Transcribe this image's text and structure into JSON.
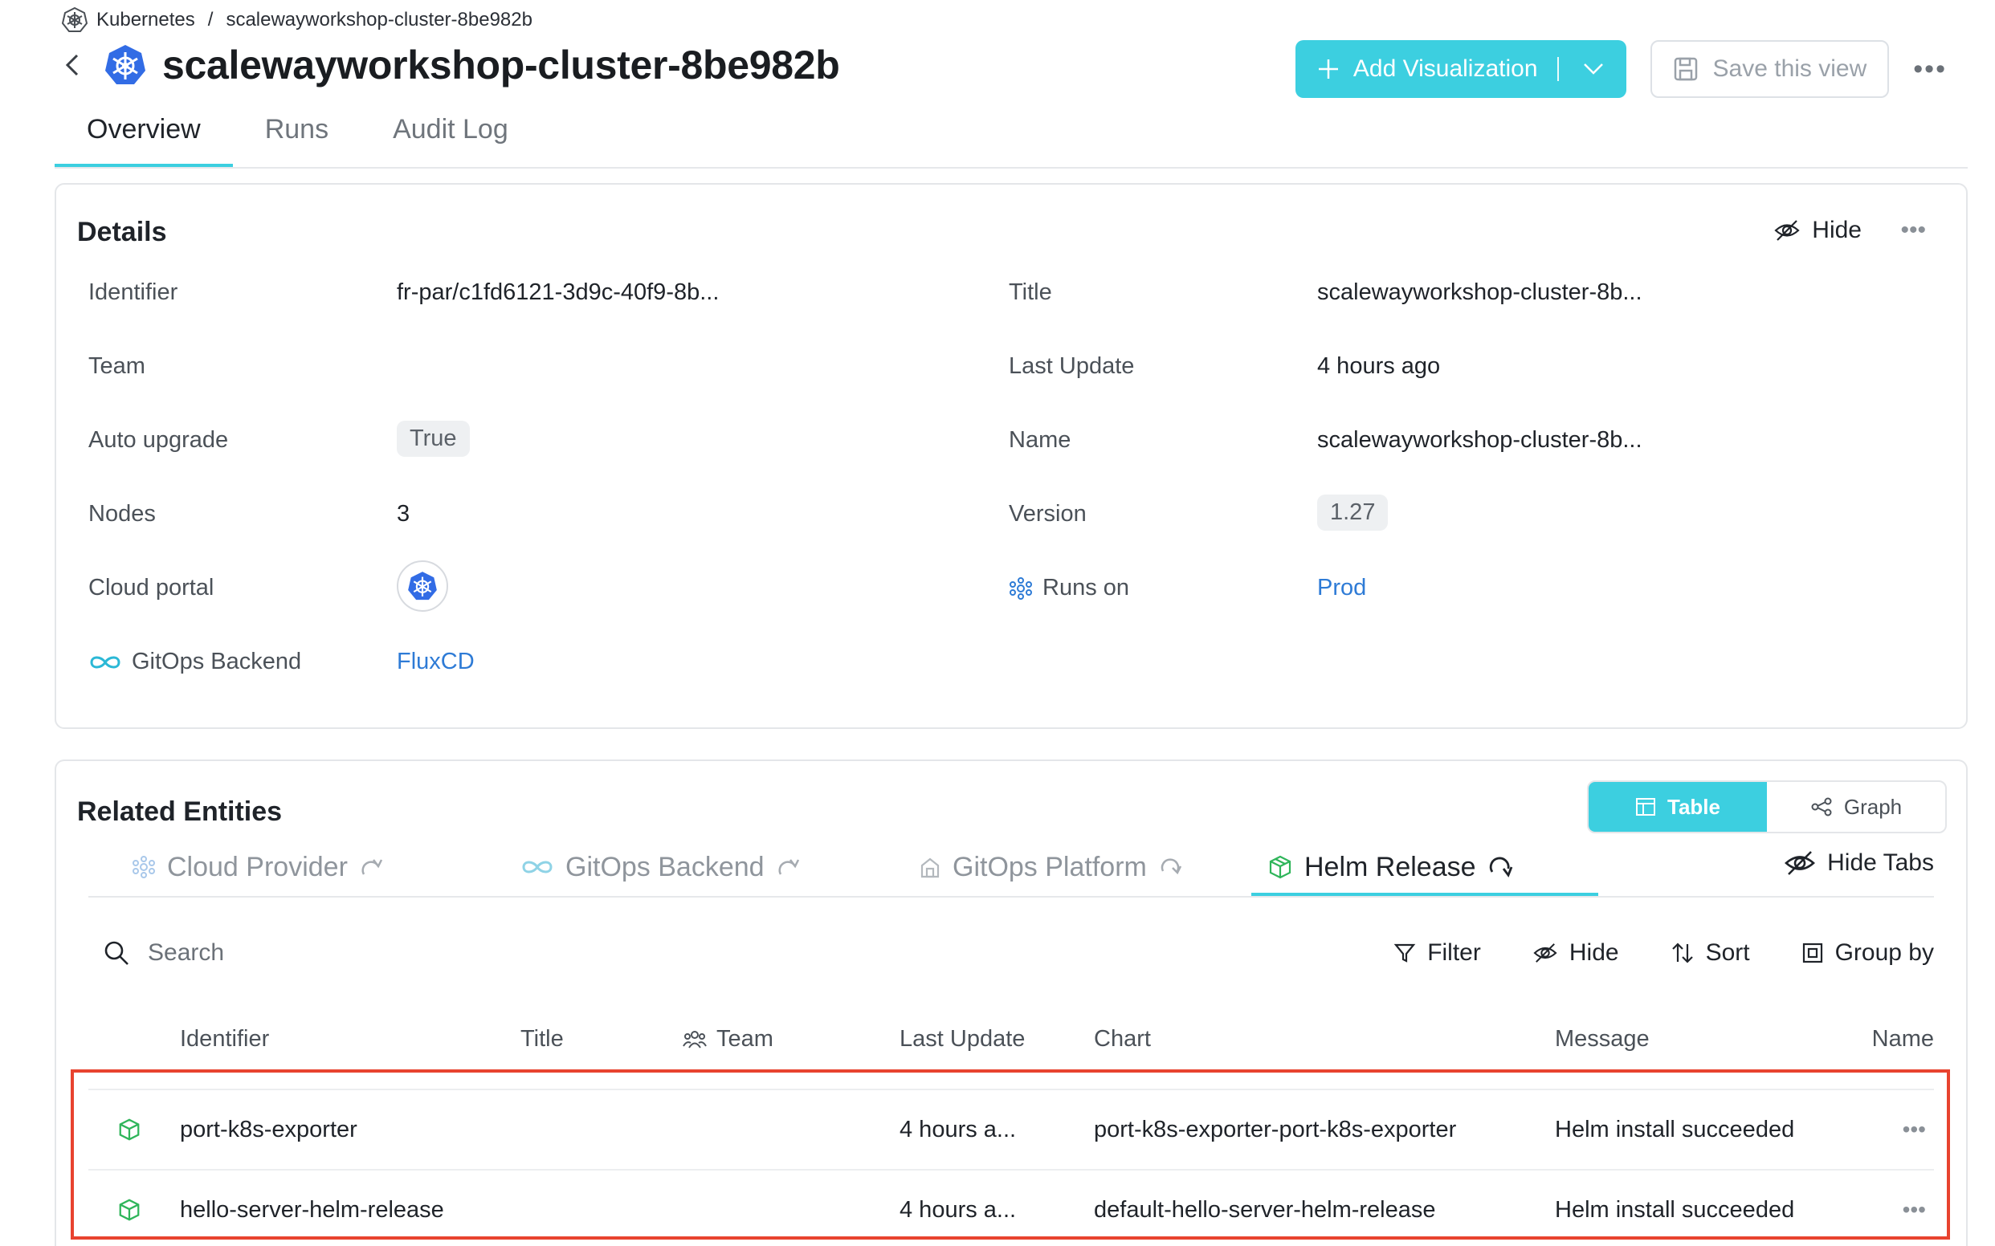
{
  "breadcrumb": {
    "root": "Kubernetes",
    "separator": "/",
    "current": "scalewayworkshop-cluster-8be982b"
  },
  "header": {
    "title": "scalewayworkshop-cluster-8be982b"
  },
  "actions": {
    "add_visualization": "Add Visualization",
    "save_view": "Save this view"
  },
  "tabs": [
    "Overview",
    "Runs",
    "Audit Log"
  ],
  "details": {
    "title": "Details",
    "hide": "Hide",
    "left": [
      {
        "label": "Identifier",
        "value": "fr-par/c1fd6121-3d9c-40f9-8b..."
      },
      {
        "label": "Team",
        "value": ""
      },
      {
        "label": "Auto upgrade",
        "value": "True"
      },
      {
        "label": "Nodes",
        "value": "3"
      },
      {
        "label": "Cloud portal",
        "value": ""
      },
      {
        "label": "GitOps Backend",
        "value": "FluxCD"
      }
    ],
    "right": [
      {
        "label": "Title",
        "value": "scalewayworkshop-cluster-8b..."
      },
      {
        "label": "Last Update",
        "value": "4 hours ago"
      },
      {
        "label": "Name",
        "value": "scalewayworkshop-cluster-8b..."
      },
      {
        "label": "Version",
        "value": "1.27"
      },
      {
        "label": "Runs on",
        "value": "Prod"
      }
    ]
  },
  "related": {
    "title": "Related Entities",
    "toggle": {
      "table": "Table",
      "graph": "Graph"
    },
    "tabs": [
      "Cloud Provider",
      "GitOps Backend",
      "GitOps Platform",
      "Helm Release"
    ],
    "hide_tabs": "Hide Tabs",
    "search_placeholder": "Search",
    "toolbar": {
      "filter": "Filter",
      "hide": "Hide",
      "sort": "Sort",
      "group_by": "Group by"
    },
    "columns": [
      "Identifier",
      "Title",
      "Team",
      "Last Update",
      "Chart",
      "Message",
      "Name"
    ],
    "rows": [
      {
        "identifier": "port-k8s-exporter",
        "title": "",
        "team": "",
        "last_update": "4 hours a...",
        "chart": "port-k8s-exporter-port-k8s-exporter",
        "message": "Helm install succeeded"
      },
      {
        "identifier": "hello-server-helm-release",
        "title": "",
        "team": "",
        "last_update": "4 hours a...",
        "chart": "default-hello-server-helm-release",
        "message": "Helm install succeeded"
      }
    ]
  },
  "colors": {
    "accent": "#3ccfe0",
    "link": "#2e7bd6",
    "highlight": "#e8432f",
    "kubernetes": "#326ce5",
    "helm_green": "#2fb55a"
  }
}
